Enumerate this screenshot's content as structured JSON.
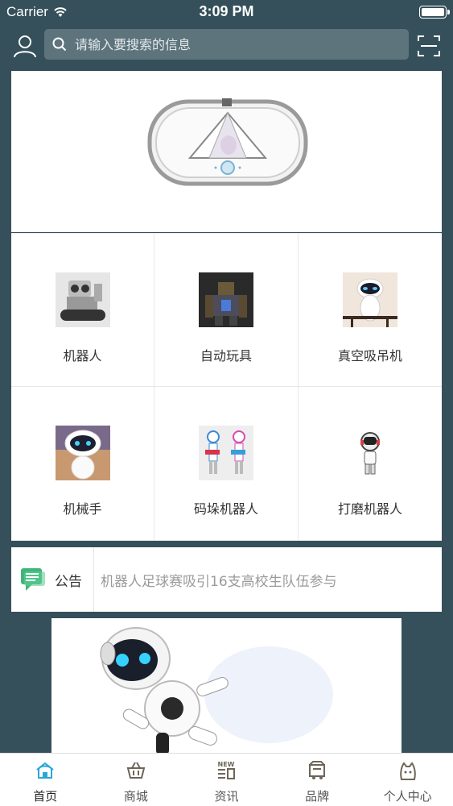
{
  "status_bar": {
    "carrier": "Carrier",
    "time": "3:09 PM"
  },
  "search": {
    "placeholder": "请输入要搜索的信息"
  },
  "categories": [
    {
      "label": "机器人",
      "icon": "tracked-robot-image"
    },
    {
      "label": "自动玩具",
      "icon": "mech-robot-image"
    },
    {
      "label": "真空吸吊机",
      "icon": "eve-robot-image"
    },
    {
      "label": "机械手",
      "icon": "round-robot-image"
    },
    {
      "label": "码垛机器人",
      "icon": "guitar-robots-image"
    },
    {
      "label": "打磨机器人",
      "icon": "mini-robot-image"
    }
  ],
  "notice": {
    "title": "公告",
    "text": "机器人足球赛吸引16支高校生队伍参与"
  },
  "tabs": [
    {
      "label": "首页",
      "icon": "home-icon",
      "active": true
    },
    {
      "label": "商城",
      "icon": "basket-icon",
      "active": false
    },
    {
      "label": "资讯",
      "icon": "news-icon",
      "active": false
    },
    {
      "label": "品牌",
      "icon": "brand-icon",
      "active": false
    },
    {
      "label": "个人中心",
      "icon": "profile-icon",
      "active": false
    }
  ],
  "colors": {
    "header_bg": "#35505a",
    "search_bg": "#5e747c",
    "accent": "#29a7d8",
    "notice_icon": "#3fb57a"
  }
}
